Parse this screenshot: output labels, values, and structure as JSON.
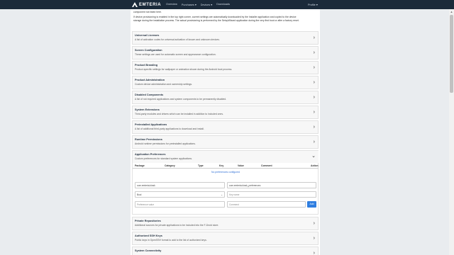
{
  "nav": {
    "brand": "EMTERIA",
    "links": [
      "Overview",
      "Purchases ▾",
      "Devices ▾",
      "Downloads"
    ],
    "profile": "Profile ▾"
  },
  "intro": {
    "line1": "component not listed here.",
    "line2": "If device provisioning is enabled in the top right corner, current settings are automatically downloaded by the Installer application and copied to the device",
    "line3": "storage during the installation process. The actual provisioning is performed by the SetupWizard application during the very first boot or after a factory reset."
  },
  "sections_top": [
    {
      "title": "Universal Licenses",
      "desc": "A list of activation codes for universal activation of known and unknown devices."
    },
    {
      "title": "Screen Configuration",
      "desc": "These settings are used for automatic screen and appearance configuration."
    },
    {
      "title": "Product Branding",
      "desc": "Product-specific settings for wallpaper or animation shown during the Android boot process."
    },
    {
      "title": "Product Administration",
      "desc": "Custom device administration and ownership settings."
    },
    {
      "title": "Disabled Components",
      "desc": "A list of not required applications and system components to be permanently disabled."
    },
    {
      "title": "System Extensions",
      "desc": "Third-party modules and drivers which can be installed in addition to included ones."
    },
    {
      "title": "Preinstalled Applications",
      "desc": "A list of additional third-party applications to download and install."
    },
    {
      "title": "Runtime Permissions",
      "desc": "Android runtime permissions for preinstalled applications."
    }
  ],
  "app_prefs": {
    "title": "Application Preferences",
    "desc": "Custom preferences for standard system applications.",
    "columns": [
      "Package",
      "Category",
      "Type",
      "Key",
      "Value",
      "Comment",
      "Action"
    ],
    "empty": "No preferences configured",
    "package_value": "com.emteria.kiosk",
    "category_value": "com.emteria.kiosk_preferences",
    "type_value": "Bool",
    "key_placeholder": "Key name",
    "value_placeholder": "Preference value",
    "comment_placeholder": "Comment",
    "add_label": "Add"
  },
  "sections_bottom": [
    {
      "title": "Private Repositories",
      "desc": "Additional sources for private applications to be included into the F-Droid store."
    },
    {
      "title": "Authorized SSH Keys",
      "desc": "Public keys in OpenSSH format to add to the list of authorized keys."
    },
    {
      "title": "System Connectivity",
      "desc": ""
    }
  ]
}
